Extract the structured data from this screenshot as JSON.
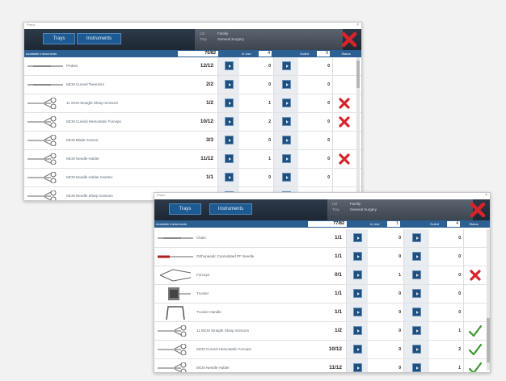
{
  "colors": {
    "header_btn": "#1d5a92",
    "column_header": "#2c5f92",
    "status_fail": "#d8232a",
    "status_ok": "#3a9a2d"
  },
  "window1": {
    "title": "Preps",
    "nav": {
      "trays_label": "Trays",
      "instruments_label": "Instruments"
    },
    "info": {
      "key1": "Lbl",
      "val1": "Family",
      "key2": "Tray",
      "val2": "General Surgery"
    },
    "close_icon": "close-x-icon",
    "columns": {
      "available_label": "Available Instruments",
      "available_value": "70/82",
      "in_use_label": "In Use",
      "in_use_value": "4",
      "soiled_label": "Soiled",
      "soiled_value": "0",
      "status_label": "Status"
    },
    "rows": [
      {
        "name": "Probes",
        "count": "12/12",
        "in_use": "0",
        "soiled": "0",
        "status": "",
        "img": "probe"
      },
      {
        "name": "MCM Curved Tweezers",
        "count": "2/2",
        "in_use": "0",
        "soiled": "0",
        "status": "",
        "img": "probe"
      },
      {
        "name": "11 SCM Straight Sharp Scissors",
        "count": "1/2",
        "in_use": "1",
        "soiled": "0",
        "status": "fail",
        "img": "scissors"
      },
      {
        "name": "MCM Curved Hemostatic Forceps",
        "count": "10/12",
        "in_use": "2",
        "soiled": "0",
        "status": "fail",
        "img": "scissors"
      },
      {
        "name": "MCM Blade Scissor",
        "count": "3/3",
        "in_use": "0",
        "soiled": "0",
        "status": "",
        "img": "scissors"
      },
      {
        "name": "MCM Needle Holder",
        "count": "11/12",
        "in_use": "1",
        "soiled": "0",
        "status": "fail",
        "img": "scissors"
      },
      {
        "name": "MCM Needle Holder Inserter",
        "count": "1/1",
        "in_use": "0",
        "soiled": "0",
        "status": "",
        "img": "scissors"
      },
      {
        "name": "MCM Needle Sharp Scissors",
        "count": "",
        "in_use": "",
        "soiled": "",
        "status": "",
        "img": "scissors"
      }
    ]
  },
  "window2": {
    "title": "Preps",
    "nav": {
      "trays_label": "Trays",
      "instruments_label": "Instruments"
    },
    "info": {
      "key1": "Lbl",
      "val1": "Family",
      "key2": "Tray",
      "val2": "General Surgery"
    },
    "close_icon": "close-x-icon",
    "columns": {
      "available_label": "Available Instruments",
      "available_value": "77/82",
      "in_use_label": "In Use",
      "in_use_value": "1",
      "soiled_label": "Soiled",
      "soiled_value": "4",
      "status_label": "Status"
    },
    "rows": [
      {
        "name": "Chain",
        "count": "1/1",
        "in_use": "0",
        "soiled": "0",
        "status": "",
        "img": "probe"
      },
      {
        "name": "Orthopaedic Cannulated PF Needle",
        "count": "1/1",
        "in_use": "0",
        "soiled": "0",
        "status": "",
        "img": "needle-red"
      },
      {
        "name": "Forceps",
        "count": "0/1",
        "in_use": "1",
        "soiled": "0",
        "status": "fail",
        "img": "forceps"
      },
      {
        "name": "Trocker",
        "count": "1/1",
        "in_use": "0",
        "soiled": "0",
        "status": "",
        "img": "trocar"
      },
      {
        "name": "Trocker Handle",
        "count": "1/1",
        "in_use": "0",
        "soiled": "0",
        "status": "",
        "img": "handle"
      },
      {
        "name": "11 MCM Straight Sharp Scissors",
        "count": "1/2",
        "in_use": "0",
        "soiled": "1",
        "status": "ok",
        "img": "scissors"
      },
      {
        "name": "MCM Curved Hemostatic Forceps",
        "count": "10/12",
        "in_use": "0",
        "soiled": "2",
        "status": "ok",
        "img": "scissors"
      },
      {
        "name": "MCM Needle Holder",
        "count": "11/12",
        "in_use": "0",
        "soiled": "1",
        "status": "ok",
        "img": "scissors"
      }
    ]
  }
}
